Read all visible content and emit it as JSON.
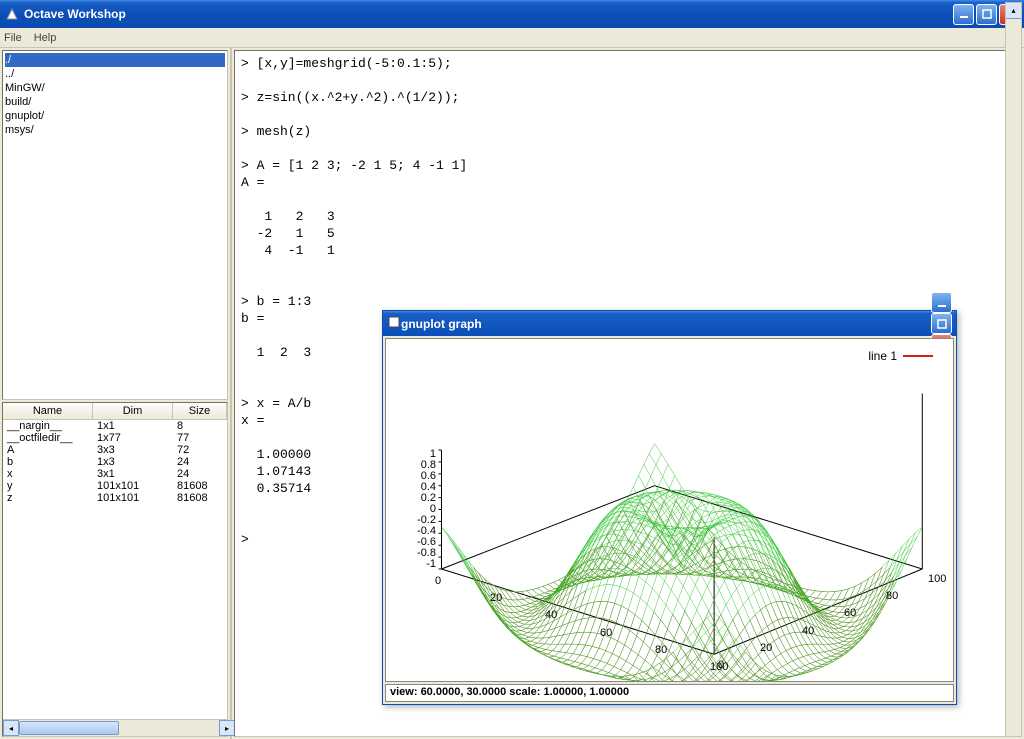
{
  "window": {
    "title": "Octave Workshop",
    "min_tip": "Minimize",
    "max_tip": "Maximize",
    "close_tip": "Close"
  },
  "menu": {
    "file": "File",
    "help": "Help"
  },
  "file_browser": {
    "items": [
      "./",
      "../",
      "MinGW/",
      "build/",
      "gnuplot/",
      "msys/"
    ],
    "selected_index": 0
  },
  "var_table": {
    "cols": {
      "name": "Name",
      "dim": "Dim",
      "size": "Size"
    },
    "rows": [
      {
        "name": "__nargin__",
        "dim": "1x1",
        "size": "8"
      },
      {
        "name": "__octfiledir__",
        "dim": "1x77",
        "size": "77"
      },
      {
        "name": "A",
        "dim": "3x3",
        "size": "72"
      },
      {
        "name": "b",
        "dim": "1x3",
        "size": "24"
      },
      {
        "name": "x",
        "dim": "3x1",
        "size": "24"
      },
      {
        "name": "y",
        "dim": "101x101",
        "size": "81608"
      },
      {
        "name": "z",
        "dim": "101x101",
        "size": "81608"
      }
    ]
  },
  "console_text": "> [x,y]=meshgrid(-5:0.1:5);\n\n> z=sin((x.^2+y.^2).^(1/2));\n\n> mesh(z)\n\n> A = [1 2 3; -2 1 5; 4 -1 1]\nA =\n\n   1   2   3\n  -2   1   5\n   4  -1   1\n\n\n> b = 1:3\nb =\n\n  1  2  3\n\n\n> x = A/b\nx =\n\n  1.00000\n  1.07143\n  0.35714\n\n\n> ",
  "gnuplot": {
    "title": "gnuplot graph",
    "legend": "line 1",
    "status": "view: 60.0000, 30.0000   scale: 1.00000, 1.00000",
    "z_ticks": [
      "1",
      "0.8",
      "0.6",
      "0.4",
      "0.2",
      "0",
      "-0.2",
      "-0.4",
      "-0.6",
      "-0.8",
      "-1"
    ],
    "x_ticks": [
      "0",
      "20",
      "40",
      "60",
      "80",
      "100"
    ],
    "y_ticks": [
      "0",
      "20",
      "40",
      "60",
      "80",
      "100"
    ]
  },
  "chart_data": {
    "type": "surface",
    "title": "",
    "expression": "z = sin(sqrt(x^2 + y^2)) over meshgrid(-5:0.1:5)",
    "x": {
      "min": 0,
      "max": 100,
      "label": ""
    },
    "y": {
      "min": 0,
      "max": 100,
      "label": ""
    },
    "z": {
      "min": -1,
      "max": 1,
      "label": ""
    },
    "series": [
      {
        "name": "line 1",
        "color": "#d02020"
      }
    ],
    "view": {
      "azimuth": 60.0,
      "elevation": 30.0,
      "scale": [
        1.0,
        1.0
      ]
    }
  }
}
